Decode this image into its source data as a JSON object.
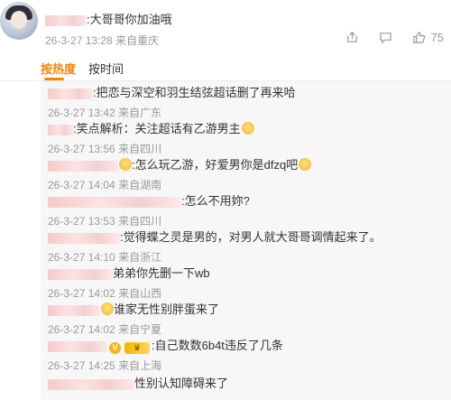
{
  "top_comment": {
    "text": ":大哥哥你加油哦",
    "time": "26-3-27 13:28",
    "location": "来自重庆",
    "like_count": "75"
  },
  "tabs": [
    {
      "label": "按热度",
      "active": true
    },
    {
      "label": "按时间",
      "active": false
    }
  ],
  "replies": [
    {
      "text": ":把恋与深空和羽生结弦超话删了再来哈",
      "time": "26-3-27 13:42",
      "location": "来自广东"
    },
    {
      "text": ":笑点解析：关注超话有乙游男主",
      "time": "26-3-27 13:56",
      "location": "来自四川",
      "emoji": "laugh-emoji"
    },
    {
      "text": ":怎么玩乙游，好爱男你是dfzq吧",
      "time": "26-3-27 14:04",
      "location": "来自湖南",
      "emoji": "shocked-emoji"
    },
    {
      "text": ":怎么不用妳?",
      "time": "26-3-27 13:53",
      "location": "来自四川"
    },
    {
      "text": ":觉得蝶之灵是男的，对男人就大哥哥调情起来了。",
      "time": "26-3-27 14:10",
      "location": "来自浙江"
    },
    {
      "text": "弟弟你先删一下wb",
      "time": "26-3-27 14:02",
      "location": "来自山西"
    },
    {
      "text": "谁家无性别胖蛋来了",
      "time": "26-3-27 14:02",
      "location": "来自宁夏"
    },
    {
      "text": ":自己数数6b4t违反了几条",
      "time": "26-3-27 14:25",
      "location": "来自上海",
      "badge": "V"
    },
    {
      "text": "性别认知障碍来了",
      "time": "",
      "location": ""
    }
  ]
}
